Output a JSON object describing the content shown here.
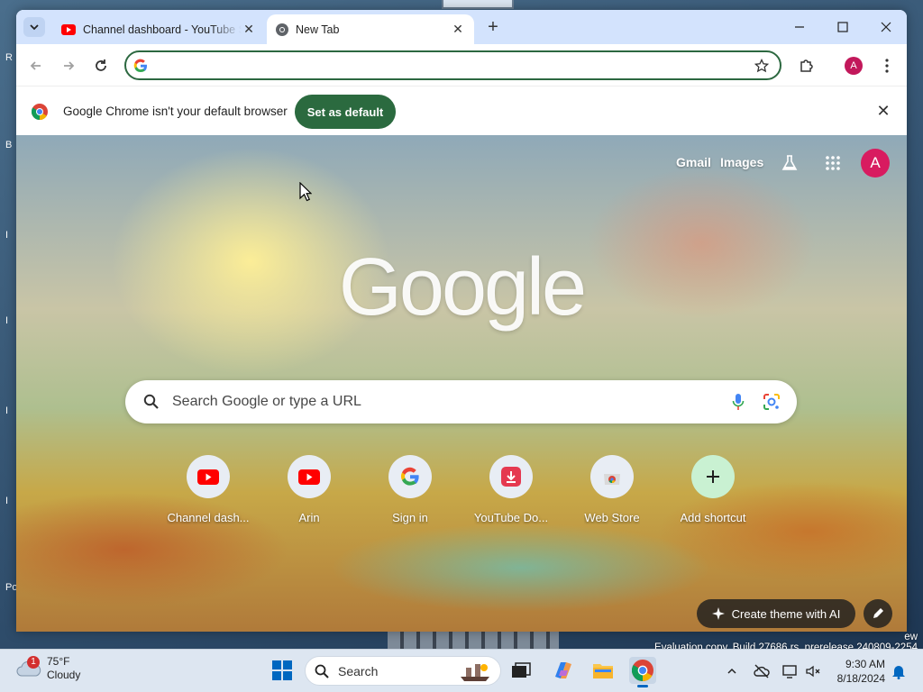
{
  "desktop": {
    "peek_letters": [
      "R",
      "B",
      "I",
      "I",
      "I",
      "I",
      "Po"
    ],
    "watermark_line1": "ew",
    "watermark_line2": "Evaluation copy. Build 27686.rs_prerelease.240809-2254"
  },
  "browser": {
    "tabs": [
      {
        "title": "Channel dashboard - YouTube Studio",
        "icon": "youtube-icon",
        "active": false
      },
      {
        "title": "New Tab",
        "icon": "chrome-icon",
        "active": true
      }
    ],
    "omnibox": {
      "value": "",
      "placeholder": ""
    },
    "profile_initial": "A",
    "infobar": {
      "message": "Google Chrome isn't your default browser",
      "button_label": "Set as default"
    }
  },
  "ntp": {
    "top_links": {
      "gmail": "Gmail",
      "images": "Images"
    },
    "avatar_initial": "A",
    "logo_text": "Google",
    "search": {
      "placeholder": "Search Google or type a URL"
    },
    "shortcuts": [
      {
        "label": "Channel dash...",
        "icon": "youtube-icon"
      },
      {
        "label": "Arin",
        "icon": "youtube-icon"
      },
      {
        "label": "Sign in",
        "icon": "google-g-icon"
      },
      {
        "label": "YouTube Do...",
        "icon": "download-icon"
      },
      {
        "label": "Web Store",
        "icon": "webstore-icon"
      },
      {
        "label": "Add shortcut",
        "icon": "plus-icon"
      }
    ],
    "create_theme_label": "Create theme with AI"
  },
  "taskbar": {
    "weather": {
      "temp": "75°F",
      "condition": "Cloudy",
      "badge": "1"
    },
    "search_label": "Search",
    "clock": {
      "time": "9:30 AM",
      "date": "8/18/2024"
    }
  },
  "colors": {
    "accent_green": "#2b6a3f",
    "tabstrip": "#d3e3fd",
    "youtube_red": "#ff0000",
    "profile_pink": "#d81b60"
  }
}
